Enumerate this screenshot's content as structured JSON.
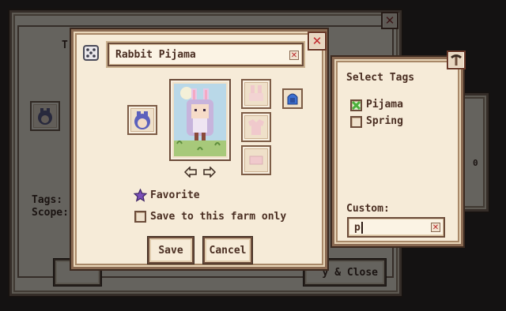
{
  "background_menu": {
    "title_fragment": "T",
    "tags_label": "Tags: C",
    "scope_label": "Scope:",
    "close_button_text": "y & Close",
    "right_glyph": "0"
  },
  "dialog": {
    "name_value": "Rabbit Pijama",
    "close_glyph": "✕",
    "clear_glyph": "✕",
    "favorite_label": "Favorite",
    "save_farm_label": "Save to this farm only",
    "save_label": "Save",
    "cancel_label": "Cancel"
  },
  "tags_panel": {
    "title": "Select Tags",
    "tags": [
      {
        "label": "Pijama",
        "checked": true
      },
      {
        "label": "Spring",
        "checked": false
      }
    ],
    "custom_label": "Custom:",
    "custom_value": "p",
    "clear_glyph": "✕"
  },
  "colors": {
    "accent_purple": "#7a4fb8",
    "check_green": "#4caf3c",
    "close_red": "#c0262a"
  }
}
